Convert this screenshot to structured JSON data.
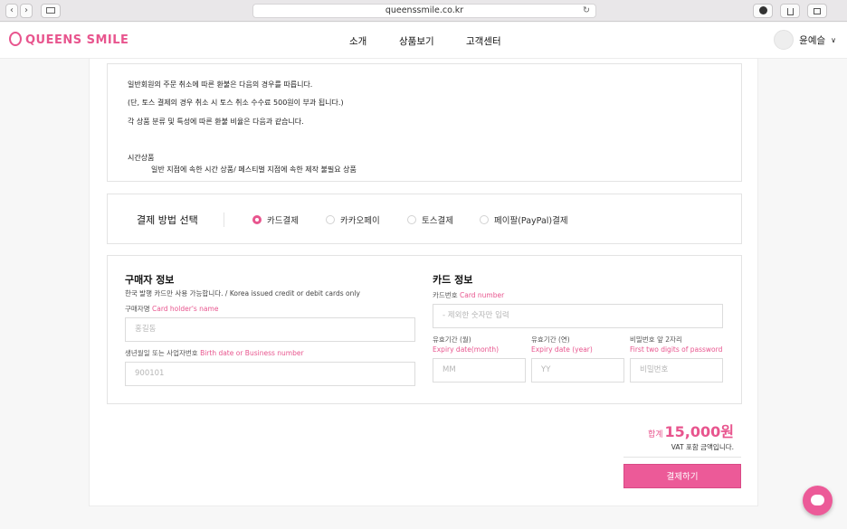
{
  "browser": {
    "url": "queenssmile.co.kr",
    "back_icon": "‹",
    "forward_icon": "›",
    "reload_icon": "↻"
  },
  "header": {
    "logo_text": "QUEENS SMILE",
    "nav": [
      "소개",
      "상품보기",
      "고객센터"
    ],
    "user_name": "윤예슬",
    "user_chevron": "∨"
  },
  "policy": {
    "lines": [
      "일반회원의 주문 취소에 따른 환불은 다음의 경우를 따릅니다.",
      "(단, 토스 결제의 경우 취소 시 토스 취소 수수료 500원이 부과 됩니다.)",
      "각 상품 분류 및 특성에 따른 환불 비율은 다음과 같습니다.",
      "시간상품",
      "일반 지점에 속한 시간 상품/ 페스티벌 지점에 속한 제작 불필요 상품"
    ]
  },
  "payment": {
    "label": "결제 방법 선택",
    "options": [
      "카드결제",
      "카카오페이",
      "토스결제",
      "페이팔(PayPal)결제"
    ],
    "selected_index": 0
  },
  "buyer": {
    "title": "구매자 정보",
    "notice": "한국 발행 카드만 사용 가능합니다. / Korea issued credit or debit cards only",
    "name_label": "구매자명",
    "name_label_en": "Card holder's name",
    "name_placeholder": "홍길동",
    "birth_label": "생년월일 또는 사업자번호",
    "birth_label_en": "Birth date or Business number",
    "birth_placeholder": "900101"
  },
  "card": {
    "title": "카드 정보",
    "number_label": "카드번호",
    "number_label_en": "Card number",
    "number_placeholder": "- 제외한 숫자만 입력",
    "month_label": "유효기간 (월)",
    "month_label_en": "Expiry date(month)",
    "month_placeholder": "MM",
    "year_label": "유효기간 (연)",
    "year_label_en": "Expiry date (year)",
    "year_placeholder": "YY",
    "pw_label": "비밀번호 앞 2자리",
    "pw_label_en": "First two digits of password",
    "pw_placeholder": "비밀번호"
  },
  "summary": {
    "total_label": "합계",
    "total_amount": "15,000원",
    "vat_note": "VAT 포함 금액입니다.",
    "pay_button": "결제하기"
  },
  "colors": {
    "accent": "#e8558e"
  }
}
